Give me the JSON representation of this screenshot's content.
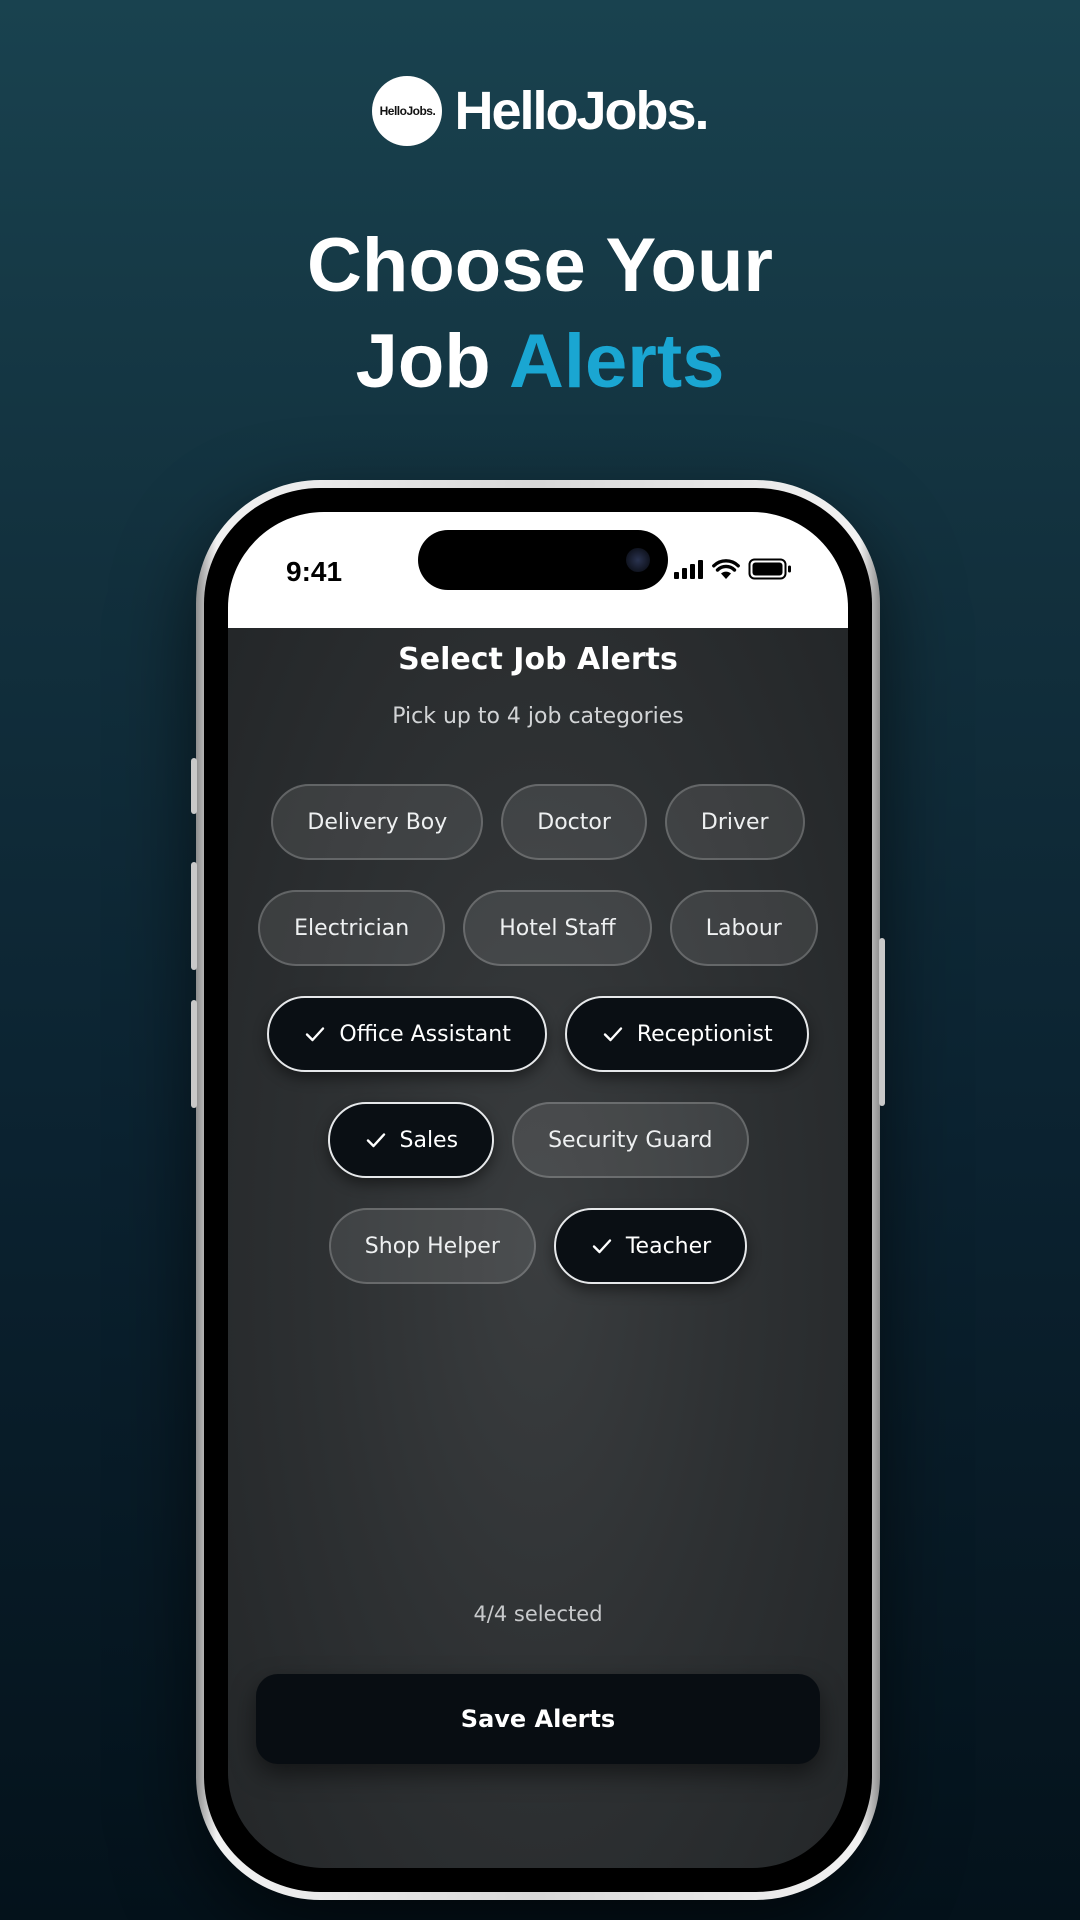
{
  "brand": {
    "logo_text": "HelloJobs.",
    "name": "HelloJobs."
  },
  "headline": {
    "line1": "Choose Your",
    "line2_prefix": "Job",
    "line2_accent": "Alerts"
  },
  "colors": {
    "accent": "#1aa6d2",
    "button_bg": "#080d12",
    "chip_selected_bg": "#0a0f14"
  },
  "status_bar": {
    "time": "9:41",
    "icons": [
      "cellular-signal-icon",
      "wifi-icon",
      "battery-icon"
    ]
  },
  "screen": {
    "title": "Select Job Alerts",
    "subtitle": "Pick up to 4 job categories",
    "chips": [
      {
        "label": "Delivery Boy",
        "selected": false
      },
      {
        "label": "Doctor",
        "selected": false
      },
      {
        "label": "Driver",
        "selected": false
      },
      {
        "label": "Electrician",
        "selected": false
      },
      {
        "label": "Hotel Staff",
        "selected": false
      },
      {
        "label": "Labour",
        "selected": false
      },
      {
        "label": "Office Assistant",
        "selected": true
      },
      {
        "label": "Receptionist",
        "selected": true
      },
      {
        "label": "Sales",
        "selected": true
      },
      {
        "label": "Security Guard",
        "selected": false
      },
      {
        "label": "Shop Helper",
        "selected": false
      },
      {
        "label": "Teacher",
        "selected": true
      }
    ],
    "selected_count": "4/4 selected",
    "save_label": "Save Alerts"
  }
}
